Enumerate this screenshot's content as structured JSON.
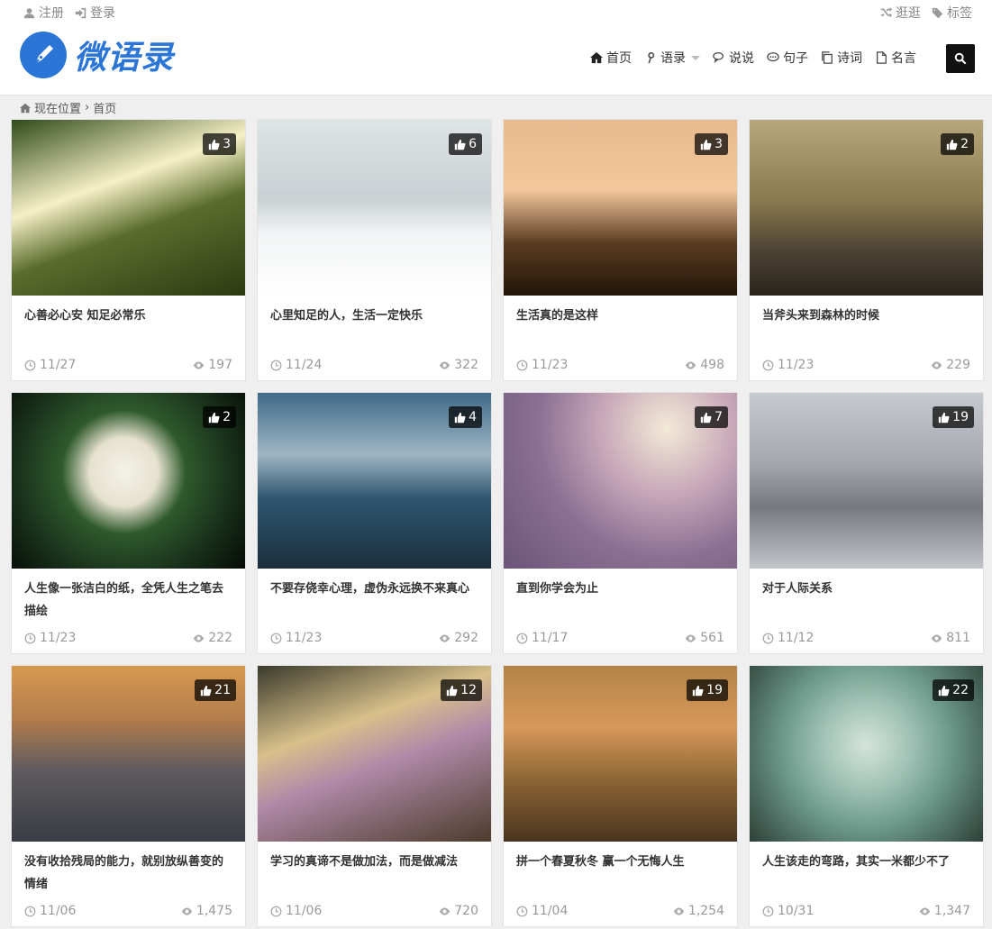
{
  "topbar": {
    "register": "注册",
    "login": "登录",
    "browse": "逛逛",
    "tags": "标签"
  },
  "logo": {
    "text": "微语录"
  },
  "nav": {
    "items": [
      {
        "label": "首页",
        "icon": "home-icon"
      },
      {
        "label": "语录",
        "icon": "quote-icon",
        "dropdown": true
      },
      {
        "label": "说说",
        "icon": "chat-icon"
      },
      {
        "label": "句子",
        "icon": "comment-icon"
      },
      {
        "label": "诗词",
        "icon": "copy-icon"
      },
      {
        "label": "名言",
        "icon": "file-icon"
      }
    ]
  },
  "breadcrumb": {
    "prefix": "现在位置",
    "current": "首页"
  },
  "colors": {
    "brand": "#2b75d6",
    "badge": "#000000"
  },
  "cards": [
    {
      "title": "心善必心安 知足必常乐",
      "likes": "3",
      "date": "11/27",
      "views": "197",
      "bg": "linear-gradient(160deg,#2f4a1a 0%,#f6f0c6 38%,#5a6d2c 60%,#2c3a12 100%)"
    },
    {
      "title": "心里知足的人，生活一定快乐",
      "likes": "6",
      "date": "11/24",
      "views": "322",
      "bg": "linear-gradient(180deg,#dfe4e6 0%,#c9d1d4 45%,#f2f4f5 65%,#ffffff 100%)"
    },
    {
      "title": "生活真的是这样",
      "likes": "3",
      "date": "11/23",
      "views": "498",
      "bg": "linear-gradient(180deg,#e8b98e 0%,#f3c79b 40%,#5b3d22 70%,#221508 100%)"
    },
    {
      "title": "当斧头来到森林的时候",
      "likes": "2",
      "date": "11/23",
      "views": "229",
      "bg": "linear-gradient(180deg,#b8a77c 0%,#8c7a4f 45%,#4b4233 75%,#2a241b 100%)"
    },
    {
      "title": "人生像一张洁白的纸，全凭人生之笔去描绘",
      "likes": "2",
      "date": "11/23",
      "views": "222",
      "bg": "radial-gradient(circle at 48% 45%,#f4f2e8 0%,#e6e2cf 22%,#2f5a2c 40%,#18301a 70%,#050a05 100%)"
    },
    {
      "title": "不要存侥幸心理，虚伪永远换不来真心",
      "likes": "4",
      "date": "11/23",
      "views": "292",
      "bg": "linear-gradient(180deg,#3f6a88 0%,#9fb6c4 35%,#2f5670 60%,#1b2f3d 100%)"
    },
    {
      "title": "直到你学会为止",
      "likes": "7",
      "date": "11/17",
      "views": "561",
      "bg": "radial-gradient(circle at 70% 20%,#f3ead7 0%,#c9a9b9 30%,#8c6f94 60%,#6a5578 100%)"
    },
    {
      "title": "对于人际关系",
      "likes": "19",
      "date": "11/12",
      "views": "811",
      "bg": "linear-gradient(180deg,#c6cbd1 0%,#a4a7ad 40%,#75797e 65%,#c2c6ca 100%)"
    },
    {
      "title": "没有收拾残局的能力，就别放纵善变的情绪",
      "likes": "21",
      "date": "11/06",
      "views": "1,475",
      "bg": "linear-gradient(180deg,#d89a4f 0%,#b37d4d 30%,#5d5a5e 60%,#3a3d44 100%)"
    },
    {
      "title": "学习的真谛不是做加法，而是做减法",
      "likes": "12",
      "date": "11/06",
      "views": "720",
      "bg": "linear-gradient(160deg,#3a3a2c 0%,#d8c08a 35%,#b08aa8 55%,#4d3b2c 100%)"
    },
    {
      "title": "拼一个春夏秋冬 赢一个无悔人生",
      "likes": "19",
      "date": "11/04",
      "views": "1,254",
      "bg": "linear-gradient(180deg,#b38447 0%,#d7995a 35%,#8b6533 65%,#4a3420 100%)"
    },
    {
      "title": "人生该走的弯路，其实一米都少不了",
      "likes": "22",
      "date": "10/31",
      "views": "1,347",
      "bg": "radial-gradient(circle at 50% 45%,#d4e4dc 0%,#9fc1b4 30%,#6d9a8a 55%,#2d3f37 100%)"
    }
  ]
}
